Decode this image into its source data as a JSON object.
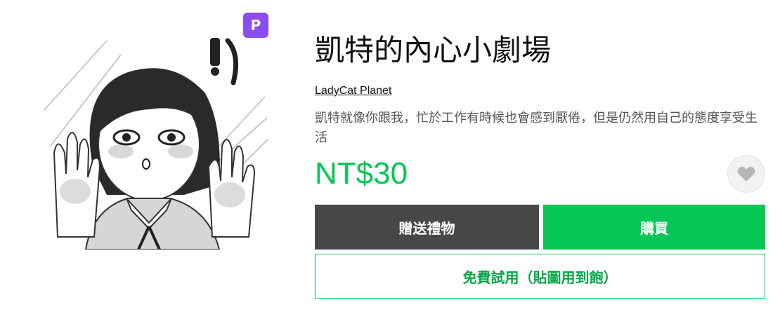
{
  "sticker": {
    "title": "凱特的內心小劇場",
    "author": "LadyCat Planet",
    "description": "凱特就像你跟我，忙於工作有時候也會感到厭倦，但是仍然用自己的態度享受生活",
    "price": "NT$30",
    "premium_badge": "P",
    "image_icon": "sticker-character"
  },
  "actions": {
    "gift_label": "贈送禮物",
    "buy_label": "購買",
    "trial_label": "免費試用（貼圖用到飽）",
    "favorite_icon": "heart-icon"
  },
  "colors": {
    "brand_green": "#06c755",
    "gift_button": "#474747",
    "premium_purple": "#8c4df0",
    "favorite_heart": "#b5b5b8"
  }
}
